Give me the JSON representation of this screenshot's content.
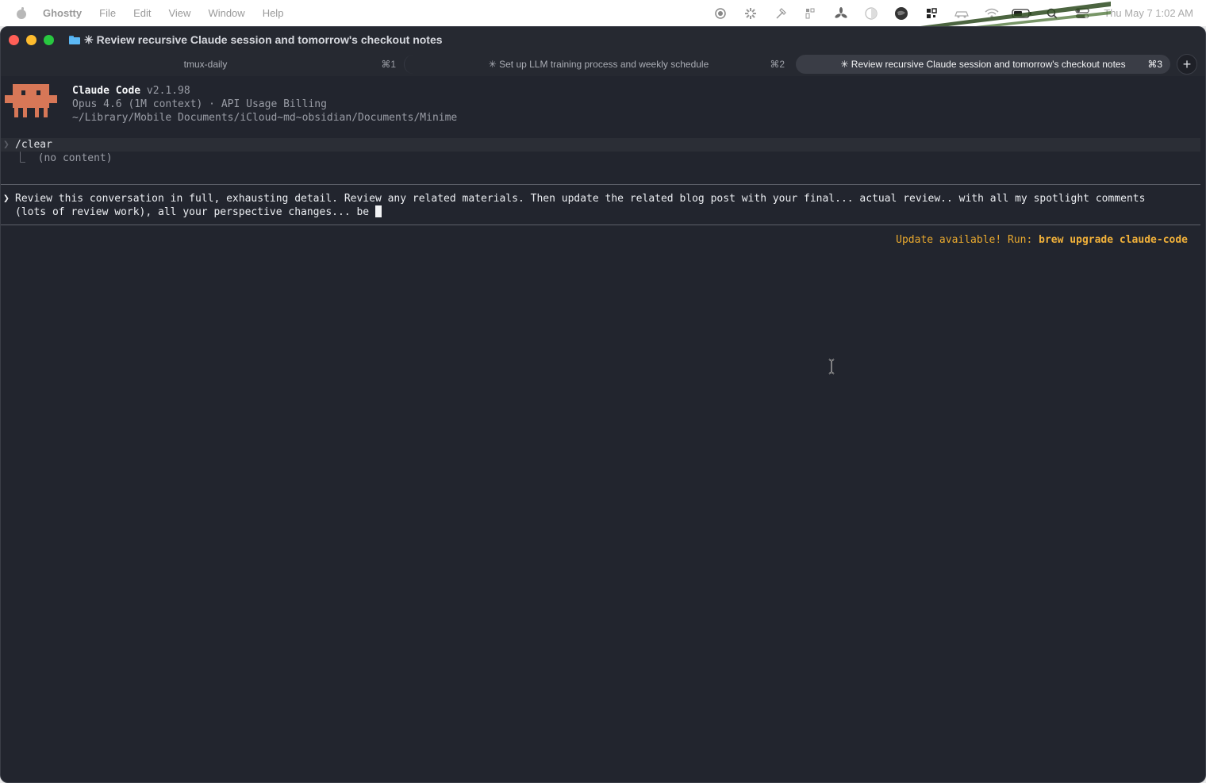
{
  "menubar": {
    "app_name": "Ghostty",
    "items": [
      "File",
      "Edit",
      "View",
      "Window",
      "Help"
    ],
    "clock": "Thu May 7  1:02 AM"
  },
  "window": {
    "title": "✳ Review recursive Claude session and tomorrow's checkout notes"
  },
  "tabs": [
    {
      "label": "tmux-daily",
      "shortcut": "⌘1",
      "active": false
    },
    {
      "label": "✳ Set up LLM training process and weekly schedule",
      "shortcut": "⌘2",
      "active": false
    },
    {
      "label": "✳ Review recursive Claude session and tomorrow's checkout notes",
      "shortcut": "⌘3",
      "active": true
    }
  ],
  "new_tab_label": "+",
  "banner": {
    "product": "Claude Code",
    "version": "v2.1.98",
    "model_line": "Opus 4.6 (1M context) · API Usage Billing",
    "path": "~/Library/Mobile Documents/iCloud~md~obsidian/Documents/Minime"
  },
  "history": {
    "command": "/clear",
    "output": "⎿  (no content)"
  },
  "prompt": {
    "line1": "Review this conversation in full, exhausting detail. Review any related materials. Then update the related blog post with your final... actual review.. with all my spotlight comments",
    "line2": "(lots of review work), all your perspective changes... be "
  },
  "update_notice": {
    "prefix": "Update available! Run: ",
    "command": "brew upgrade claude-code"
  },
  "colors": {
    "terminal_bg": "#22252e",
    "accent_orange": "#e9a92e",
    "mascot": "#d77757"
  },
  "status_icons": [
    "record-icon",
    "settings-flower-icon",
    "hammer-icon",
    "grid-icon",
    "fan-icon",
    "contrast-icon",
    "globe-icon",
    "qr-icon",
    "car-icon",
    "wifi-icon",
    "battery-icon",
    "search-icon",
    "control-center-icon"
  ]
}
